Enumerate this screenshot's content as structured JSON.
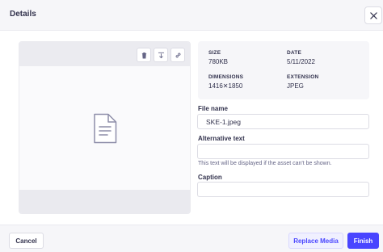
{
  "header": {
    "title": "Details",
    "close_icon": "close-icon"
  },
  "preview": {
    "tools": [
      "trash-icon",
      "download-icon",
      "link-icon"
    ],
    "placeholder_icon": "file-icon"
  },
  "meta": {
    "size_label": "SIZE",
    "size_value": "780KB",
    "date_label": "DATE",
    "date_value": "5/11/2022",
    "dimensions_label": "DIMENSIONS",
    "dimensions_value": "1416✕1850",
    "extension_label": "EXTENSION",
    "extension_value": "JPEG"
  },
  "form": {
    "file_name_label": "File name",
    "file_name_value": "SKE-1.jpeg",
    "alt_label": "Alternative text",
    "alt_value": "",
    "alt_hint": "This text will be displayed if the asset can't be shown.",
    "caption_label": "Caption",
    "caption_value": ""
  },
  "footer": {
    "cancel_label": "Cancel",
    "replace_label": "Replace Media",
    "finish_label": "Finish"
  },
  "colors": {
    "primary": "#4945ff",
    "primary_light": "#f0f0ff",
    "neutral_bg": "#f6f6f9",
    "border": "#dcdce4",
    "text": "#32324d"
  }
}
